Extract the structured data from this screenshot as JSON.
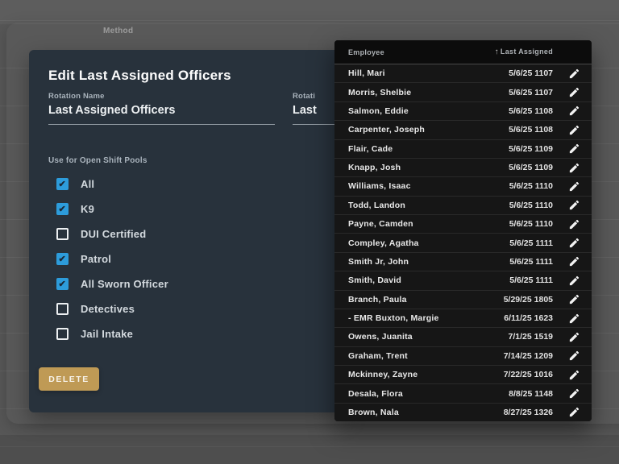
{
  "background": {
    "method_label": "Method"
  },
  "dialog": {
    "title": "Edit Last Assigned Officers",
    "fields": [
      {
        "label": "Rotation Name",
        "value": "Last Assigned Officers"
      },
      {
        "label": "Rotati",
        "value": "Last"
      }
    ],
    "checkbox_section_label": "Use for Open Shift Pools",
    "checkboxes": [
      {
        "label": "All",
        "checked": true
      },
      {
        "label": "K9",
        "checked": true
      },
      {
        "label": "DUI Certified",
        "checked": false
      },
      {
        "label": "Patrol",
        "checked": true
      },
      {
        "label": "All Sworn Officer",
        "checked": true
      },
      {
        "label": "Detectives",
        "checked": false
      },
      {
        "label": "Jail Intake",
        "checked": false
      }
    ],
    "delete_button_label": "DELETE"
  },
  "table": {
    "columns": [
      {
        "label": "Employee"
      },
      {
        "label": "Last Assigned",
        "sort_direction": "ascending",
        "sort_icon": "↑"
      }
    ],
    "edit_icon": "pencil-icon",
    "rows": [
      {
        "employee": "Hill, Mari",
        "last_assigned": "5/6/25 1107"
      },
      {
        "employee": "Morris, Shelbie",
        "last_assigned": "5/6/25 1107"
      },
      {
        "employee": "Salmon, Eddie",
        "last_assigned": "5/6/25 1108"
      },
      {
        "employee": "Carpenter, Joseph",
        "last_assigned": "5/6/25 1108"
      },
      {
        "employee": "Flair, Cade",
        "last_assigned": "5/6/25 1109"
      },
      {
        "employee": "Knapp, Josh",
        "last_assigned": "5/6/25 1109"
      },
      {
        "employee": "Williams, Isaac",
        "last_assigned": "5/6/25 1110"
      },
      {
        "employee": "Todd, Landon",
        "last_assigned": "5/6/25 1110"
      },
      {
        "employee": "Payne, Camden",
        "last_assigned": "5/6/25 1110"
      },
      {
        "employee": "Compley, Agatha",
        "last_assigned": "5/6/25 1111"
      },
      {
        "employee": "Smith Jr, John",
        "last_assigned": "5/6/25 1111"
      },
      {
        "employee": "Smith, David",
        "last_assigned": "5/6/25 1111"
      },
      {
        "employee": "Branch, Paula",
        "last_assigned": "5/29/25 1805"
      },
      {
        "employee": "- EMR Buxton, Margie",
        "last_assigned": "6/11/25 1623"
      },
      {
        "employee": "Owens, Juanita",
        "last_assigned": "7/1/25 1519"
      },
      {
        "employee": "Graham, Trent",
        "last_assigned": "7/14/25 1209"
      },
      {
        "employee": "Mckinney, Zayne",
        "last_assigned": "7/22/25 1016"
      },
      {
        "employee": "Desala, Flora",
        "last_assigned": "8/8/25 1148"
      },
      {
        "employee": "Brown, Nala",
        "last_assigned": "8/27/25 1326"
      }
    ]
  },
  "colors": {
    "accent_blue": "#2d9cdb",
    "delete_button": "#bf9a55",
    "dialog_background": "#28323c",
    "table_background": "#151515",
    "page_background": "#575757"
  }
}
